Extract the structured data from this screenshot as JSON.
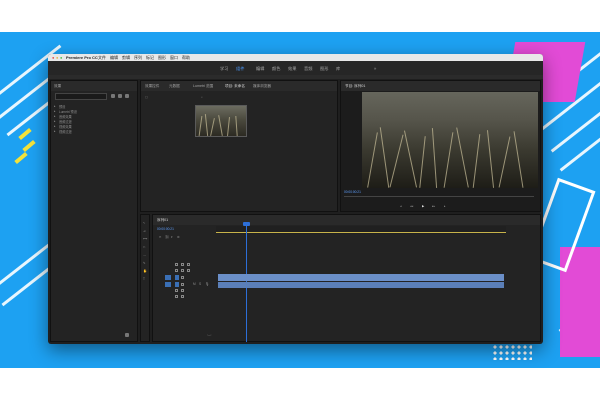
{
  "app": {
    "name": "Premiere Pro CC",
    "menu": [
      "文件",
      "编辑",
      "剪辑",
      "序列",
      "标记",
      "图形",
      "窗口",
      "帮助"
    ]
  },
  "workspace_tabs": [
    {
      "label": "学习",
      "active": false
    },
    {
      "label": "组件",
      "active": true
    },
    {
      "label": "编辑",
      "active": false
    },
    {
      "label": "颜色",
      "active": false
    },
    {
      "label": "效果",
      "active": false
    },
    {
      "label": "音频",
      "active": false
    },
    {
      "label": "图形",
      "active": false
    },
    {
      "label": "库",
      "active": false
    }
  ],
  "panels": {
    "project": {
      "tabs": [
        "效果控件",
        "元数据",
        "Lumetri 范围",
        "项目: 未命名",
        "媒体浏览器"
      ]
    },
    "source": {
      "tabs": [
        "节目: 序列01"
      ]
    },
    "effects": {
      "items": [
        "预设",
        "Lumetri 预设",
        "音频效果",
        "音频过渡",
        "视频效果",
        "视频过渡"
      ]
    },
    "timeline": {
      "title": "序列01",
      "timecode": "00:00:00:21"
    },
    "program": {
      "timecode": "00:00:00:21"
    }
  },
  "colors": {
    "accent": "#4c9bff",
    "track": "#6b8fc8",
    "bg": "#1da1f2"
  }
}
